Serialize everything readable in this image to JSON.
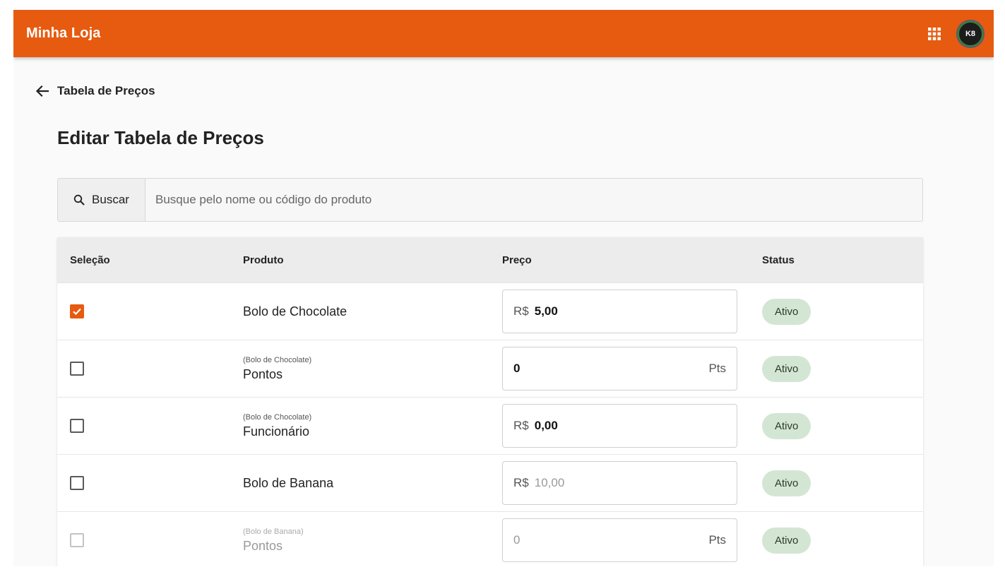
{
  "app": {
    "brand": "Minha Loja",
    "avatar_initials": "K8",
    "accent": "#e65b10"
  },
  "breadcrumb": {
    "back_label": "Tabela de Preços"
  },
  "page": {
    "title": "Editar Tabela de Preços"
  },
  "search": {
    "button_label": "Buscar",
    "placeholder": "Busque pelo nome ou código do produto"
  },
  "table": {
    "headers": {
      "selection": "Seleção",
      "product": "Produto",
      "price": "Preço",
      "status": "Status"
    },
    "rows": [
      {
        "checked": true,
        "parent": "",
        "name": "Bolo de Chocolate",
        "prefix": "R$",
        "value": "5,00",
        "suffix": "",
        "status": "Ativo"
      },
      {
        "checked": false,
        "parent": "(Bolo de Chocolate)",
        "name": "Pontos",
        "prefix": "",
        "value": "0",
        "suffix": "Pts",
        "status": "Ativo"
      },
      {
        "checked": false,
        "parent": "(Bolo de Chocolate)",
        "name": "Funcionário",
        "prefix": "R$",
        "value": "0,00",
        "suffix": "",
        "status": "Ativo"
      },
      {
        "checked": false,
        "parent": "",
        "name": "Bolo de Banana",
        "prefix": "R$",
        "value": "10,00",
        "suffix": "",
        "status": "Ativo"
      },
      {
        "checked": false,
        "parent": "(Bolo de Banana)",
        "name": "Pontos",
        "prefix": "",
        "value": "0",
        "suffix": "Pts",
        "status": "Ativo"
      }
    ]
  }
}
